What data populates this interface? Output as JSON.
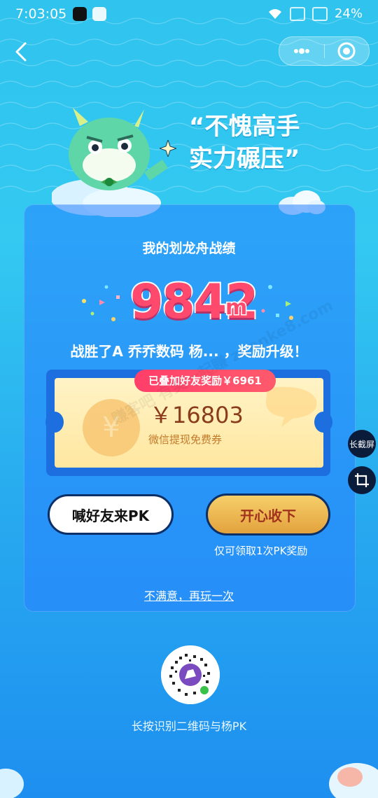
{
  "status_bar": {
    "time": "7:03:05",
    "battery": "24%"
  },
  "header": {
    "headline_line1": "“不愧高手",
    "headline_line2": "实力碾压”"
  },
  "card": {
    "title": "我的划龙舟战绩",
    "score": "9842",
    "score_unit": "m",
    "win_text": "战胜了A 乔乔数码 杨... ，奖励升级！"
  },
  "ticket": {
    "badge": "已叠加好友奖励￥6961",
    "amount": "￥16803",
    "label": "微信提现免费券"
  },
  "actions": {
    "pk_label": "喊好友来PK",
    "accept_label": "开心收下",
    "limit_note": "仅可领取1次PK奖励",
    "retry_label": "不满意，再玩一次"
  },
  "qr": {
    "caption": "长按识别二维码与杨PK"
  },
  "side": {
    "screenshot_label": "长截屏"
  },
  "watermark": "赚客吧 有奖一起赚 zuanke8.com"
}
